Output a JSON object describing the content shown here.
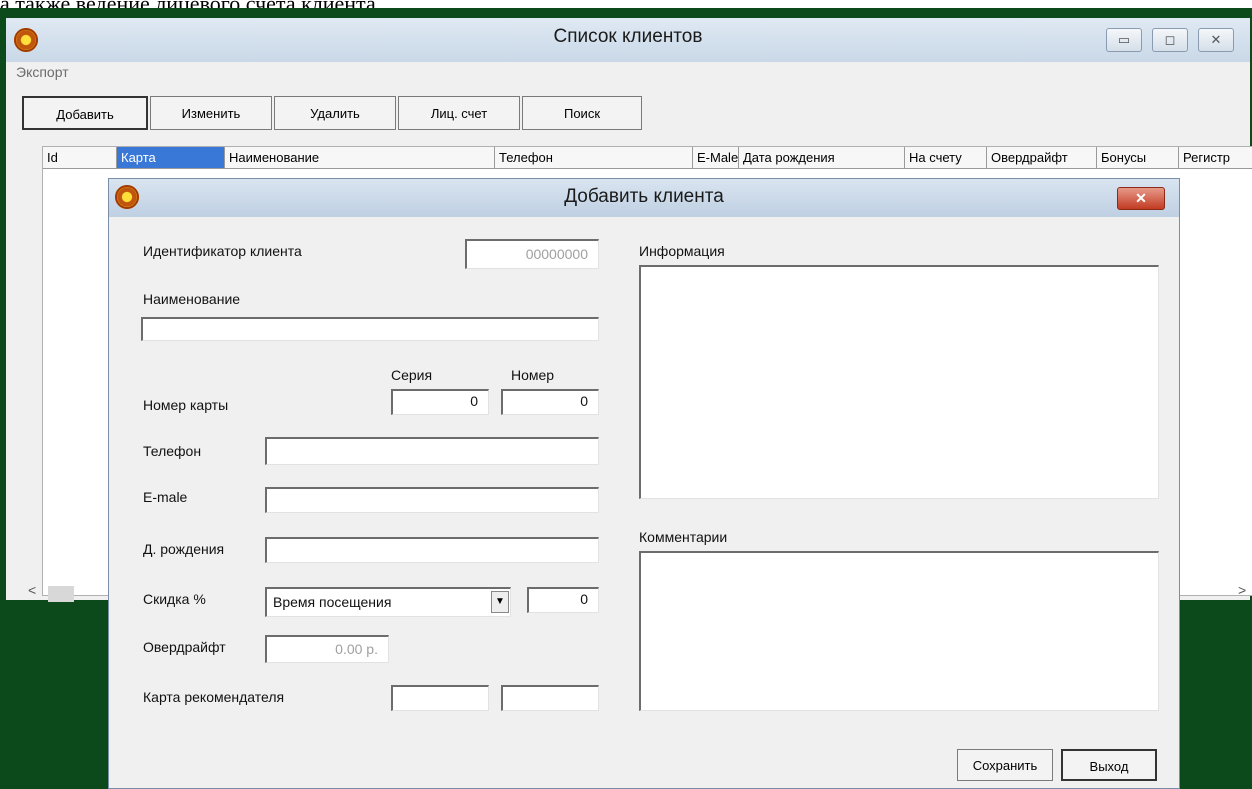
{
  "doc_text": "а также ведение лицевого счета клиента.",
  "main_window": {
    "title": "Список клиентов",
    "controls": {
      "minimize": "▭",
      "maximize": "◻",
      "close": "✕"
    },
    "menu": {
      "export": "Экспорт"
    },
    "toolbar": {
      "add": "Добавить",
      "edit": "Изменить",
      "delete": "Удалить",
      "account": "Лиц. счет",
      "search": "Поиск"
    },
    "grid_columns": [
      "Id",
      "Карта",
      "Наименование",
      "Телефон",
      "E-Male",
      "Дата рождения",
      "На счету",
      "Овердрайфт",
      "Бонусы",
      "Регистр"
    ],
    "scroll": {
      "left": "<",
      "right": ">"
    }
  },
  "dialog": {
    "title": "Добавить клиента",
    "close": "✕",
    "labels": {
      "client_id": "Идентификатор клиента",
      "name": "Наименование",
      "card_number": "Номер карты",
      "series": "Серия",
      "number": "Номер",
      "phone": "Телефон",
      "email": "E-male",
      "birth": "Д. рождения",
      "discount": "Скидка %",
      "overdraft": "Овердрайфт",
      "referrer_card": "Карта рекомендателя",
      "info": "Информация",
      "comments": "Комментарии"
    },
    "values": {
      "client_id": "00000000",
      "name": "",
      "series": "0",
      "number": "0",
      "phone": "",
      "email": "",
      "birth": "",
      "discount_type": "Время посещения",
      "discount_value": "0",
      "overdraft": "0.00 р.",
      "referrer_series": "",
      "referrer_number": "",
      "info": "",
      "comments": ""
    },
    "dropdown_arrow": "▼",
    "buttons": {
      "save": "Сохранить",
      "exit": "Выход"
    }
  },
  "colors": {
    "background": "#0c4a1c",
    "selected_header": "#3a78d8",
    "close_button": "#c23b22"
  }
}
